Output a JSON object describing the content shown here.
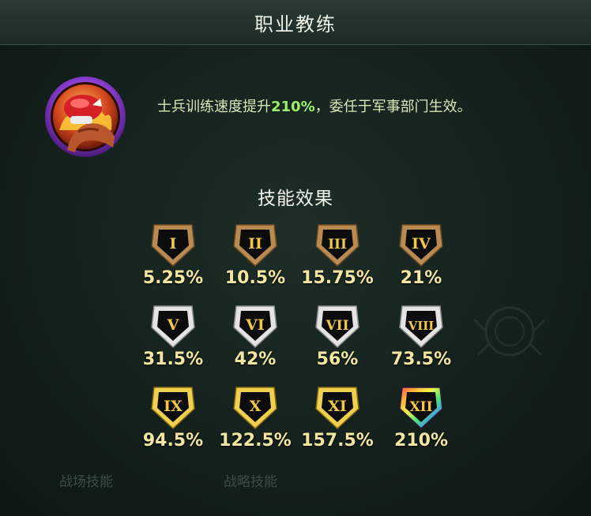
{
  "header": {
    "title": "职业教练"
  },
  "skill": {
    "icon": "boxing-glove-arm-icon",
    "desc_prefix": "士兵训练速度提升",
    "desc_value": "210%",
    "desc_suffix": "，委任于军事部门生效。"
  },
  "effects": {
    "title": "技能效果",
    "levels": [
      {
        "numeral": "I",
        "value": "5.25%",
        "tier": "bronze"
      },
      {
        "numeral": "II",
        "value": "10.5%",
        "tier": "bronze"
      },
      {
        "numeral": "III",
        "value": "15.75%",
        "tier": "bronze"
      },
      {
        "numeral": "IV",
        "value": "21%",
        "tier": "bronze"
      },
      {
        "numeral": "V",
        "value": "31.5%",
        "tier": "silver"
      },
      {
        "numeral": "VI",
        "value": "42%",
        "tier": "silver"
      },
      {
        "numeral": "VII",
        "value": "56%",
        "tier": "silver"
      },
      {
        "numeral": "VIII",
        "value": "73.5%",
        "tier": "silver"
      },
      {
        "numeral": "IX",
        "value": "94.5%",
        "tier": "gold"
      },
      {
        "numeral": "X",
        "value": "122.5%",
        "tier": "gold"
      },
      {
        "numeral": "XI",
        "value": "157.5%",
        "tier": "gold"
      },
      {
        "numeral": "XII",
        "value": "210%",
        "tier": "rainbow"
      }
    ]
  },
  "background_tabs": {
    "tab1": "战场技能",
    "tab2": "战略技能"
  },
  "colors": {
    "bronze": "#b98a52",
    "silver": "#d8d8d8",
    "gold": "#e8c64a",
    "numeral": "#f2c84b",
    "value": "#f3e6a2",
    "highlight": "#9df06a"
  }
}
